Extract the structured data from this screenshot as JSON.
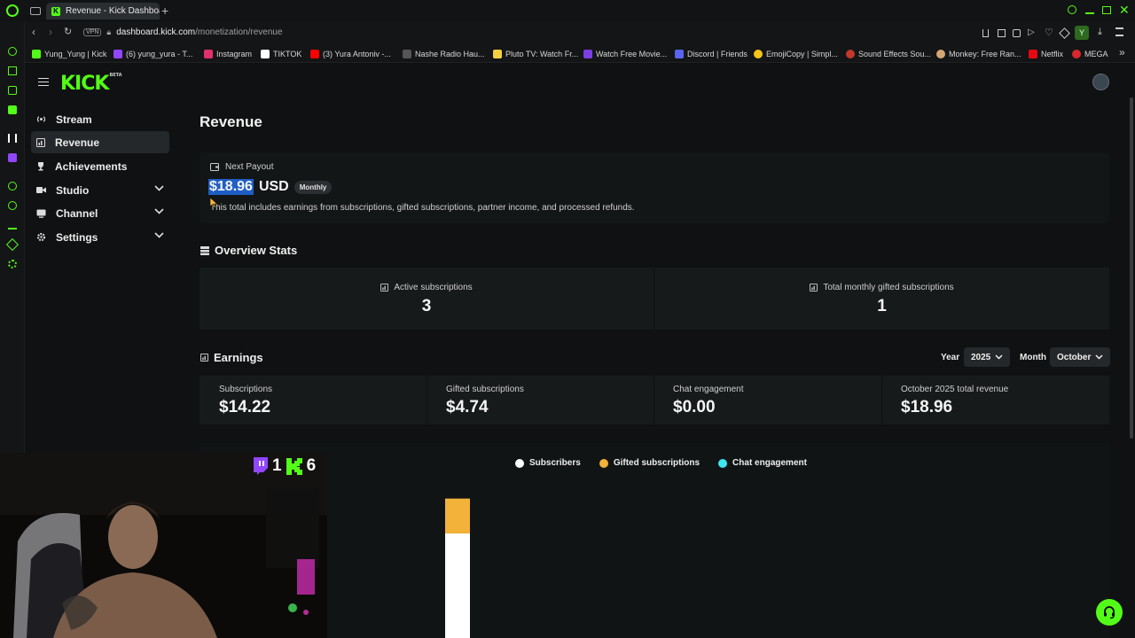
{
  "browser": {
    "tab_title": "Revenue - Kick Dashboard",
    "url_host": "dashboard.kick.com",
    "url_path": "/monetization/revenue",
    "vpn_label": "VPN",
    "profile_initial": "Y",
    "bookmarks": [
      {
        "label": "Yung_Yung | Kick",
        "color": "#53fc18"
      },
      {
        "label": "(6) yung_yura - T...",
        "color": "#9146ff"
      },
      {
        "label": "Instagram",
        "color": "#e1306c"
      },
      {
        "label": "TIKTOK",
        "color": "#ffffff"
      },
      {
        "label": "(3) Yura Antoniv -...",
        "color": "#ff0000"
      },
      {
        "label": "Nashe Radio Hau...",
        "color": "#555555"
      },
      {
        "label": "Pluto TV: Watch Fr...",
        "color": "#f4d03f"
      },
      {
        "label": "Watch Free Movie...",
        "color": "#7b3fe4"
      },
      {
        "label": "Discord | Friends",
        "color": "#5865f2"
      },
      {
        "label": "EmojiCopy | Simpl...",
        "color": "#f5c518"
      },
      {
        "label": "Sound Effects Sou...",
        "color": "#c0392b"
      },
      {
        "label": "Monkey: Free Ran...",
        "color": "#d4a574"
      },
      {
        "label": "Netflix",
        "color": "#e50914"
      },
      {
        "label": "MEGA",
        "color": "#d9272e"
      }
    ]
  },
  "app": {
    "logo_text": "KICK",
    "logo_badge": "BETA"
  },
  "sidebar": {
    "items": [
      {
        "label": "Stream",
        "icon": "broadcast-icon",
        "active": false,
        "expandable": false
      },
      {
        "label": "Revenue",
        "icon": "chart-icon",
        "active": true,
        "expandable": false
      },
      {
        "label": "Achievements",
        "icon": "trophy-icon",
        "active": false,
        "expandable": false
      },
      {
        "label": "Studio",
        "icon": "camera-icon",
        "active": false,
        "expandable": true
      },
      {
        "label": "Channel",
        "icon": "monitor-icon",
        "active": false,
        "expandable": true
      },
      {
        "label": "Settings",
        "icon": "gear-icon",
        "active": false,
        "expandable": true
      }
    ]
  },
  "page": {
    "title": "Revenue"
  },
  "payout": {
    "label": "Next Payout",
    "amount": "$18.96",
    "currency": "USD",
    "badge": "Monthly",
    "description": "This total includes earnings from subscriptions, gifted subscriptions, partner income, and processed refunds."
  },
  "overview": {
    "title": "Overview Stats",
    "stats": [
      {
        "label": "Active subscriptions",
        "value": "3"
      },
      {
        "label": "Total monthly gifted subscriptions",
        "value": "1"
      }
    ]
  },
  "earnings": {
    "title": "Earnings",
    "year_label": "Year",
    "year_value": "2025",
    "month_label": "Month",
    "month_value": "October",
    "cards": [
      {
        "label": "Subscriptions",
        "value": "$14.22"
      },
      {
        "label": "Gifted subscriptions",
        "value": "$4.74"
      },
      {
        "label": "Chat engagement",
        "value": "$0.00"
      },
      {
        "label": "October 2025 total revenue",
        "value": "$18.96"
      }
    ]
  },
  "chart_data": {
    "type": "bar",
    "stacked": true,
    "legend": [
      {
        "name": "Subscribers",
        "color": "#ffffff"
      },
      {
        "name": "Gifted subscriptions",
        "color": "#f3b23a"
      },
      {
        "name": "Chat engagement",
        "color": "#3ee6f0"
      }
    ],
    "series": [
      {
        "name": "Subscribers",
        "values": [
          14.22
        ]
      },
      {
        "name": "Gifted subscriptions",
        "values": [
          4.74
        ]
      },
      {
        "name": "Chat engagement",
        "values": [
          0.0
        ]
      }
    ]
  },
  "overlay": {
    "twitch_count": "1",
    "kick_count": "6"
  }
}
